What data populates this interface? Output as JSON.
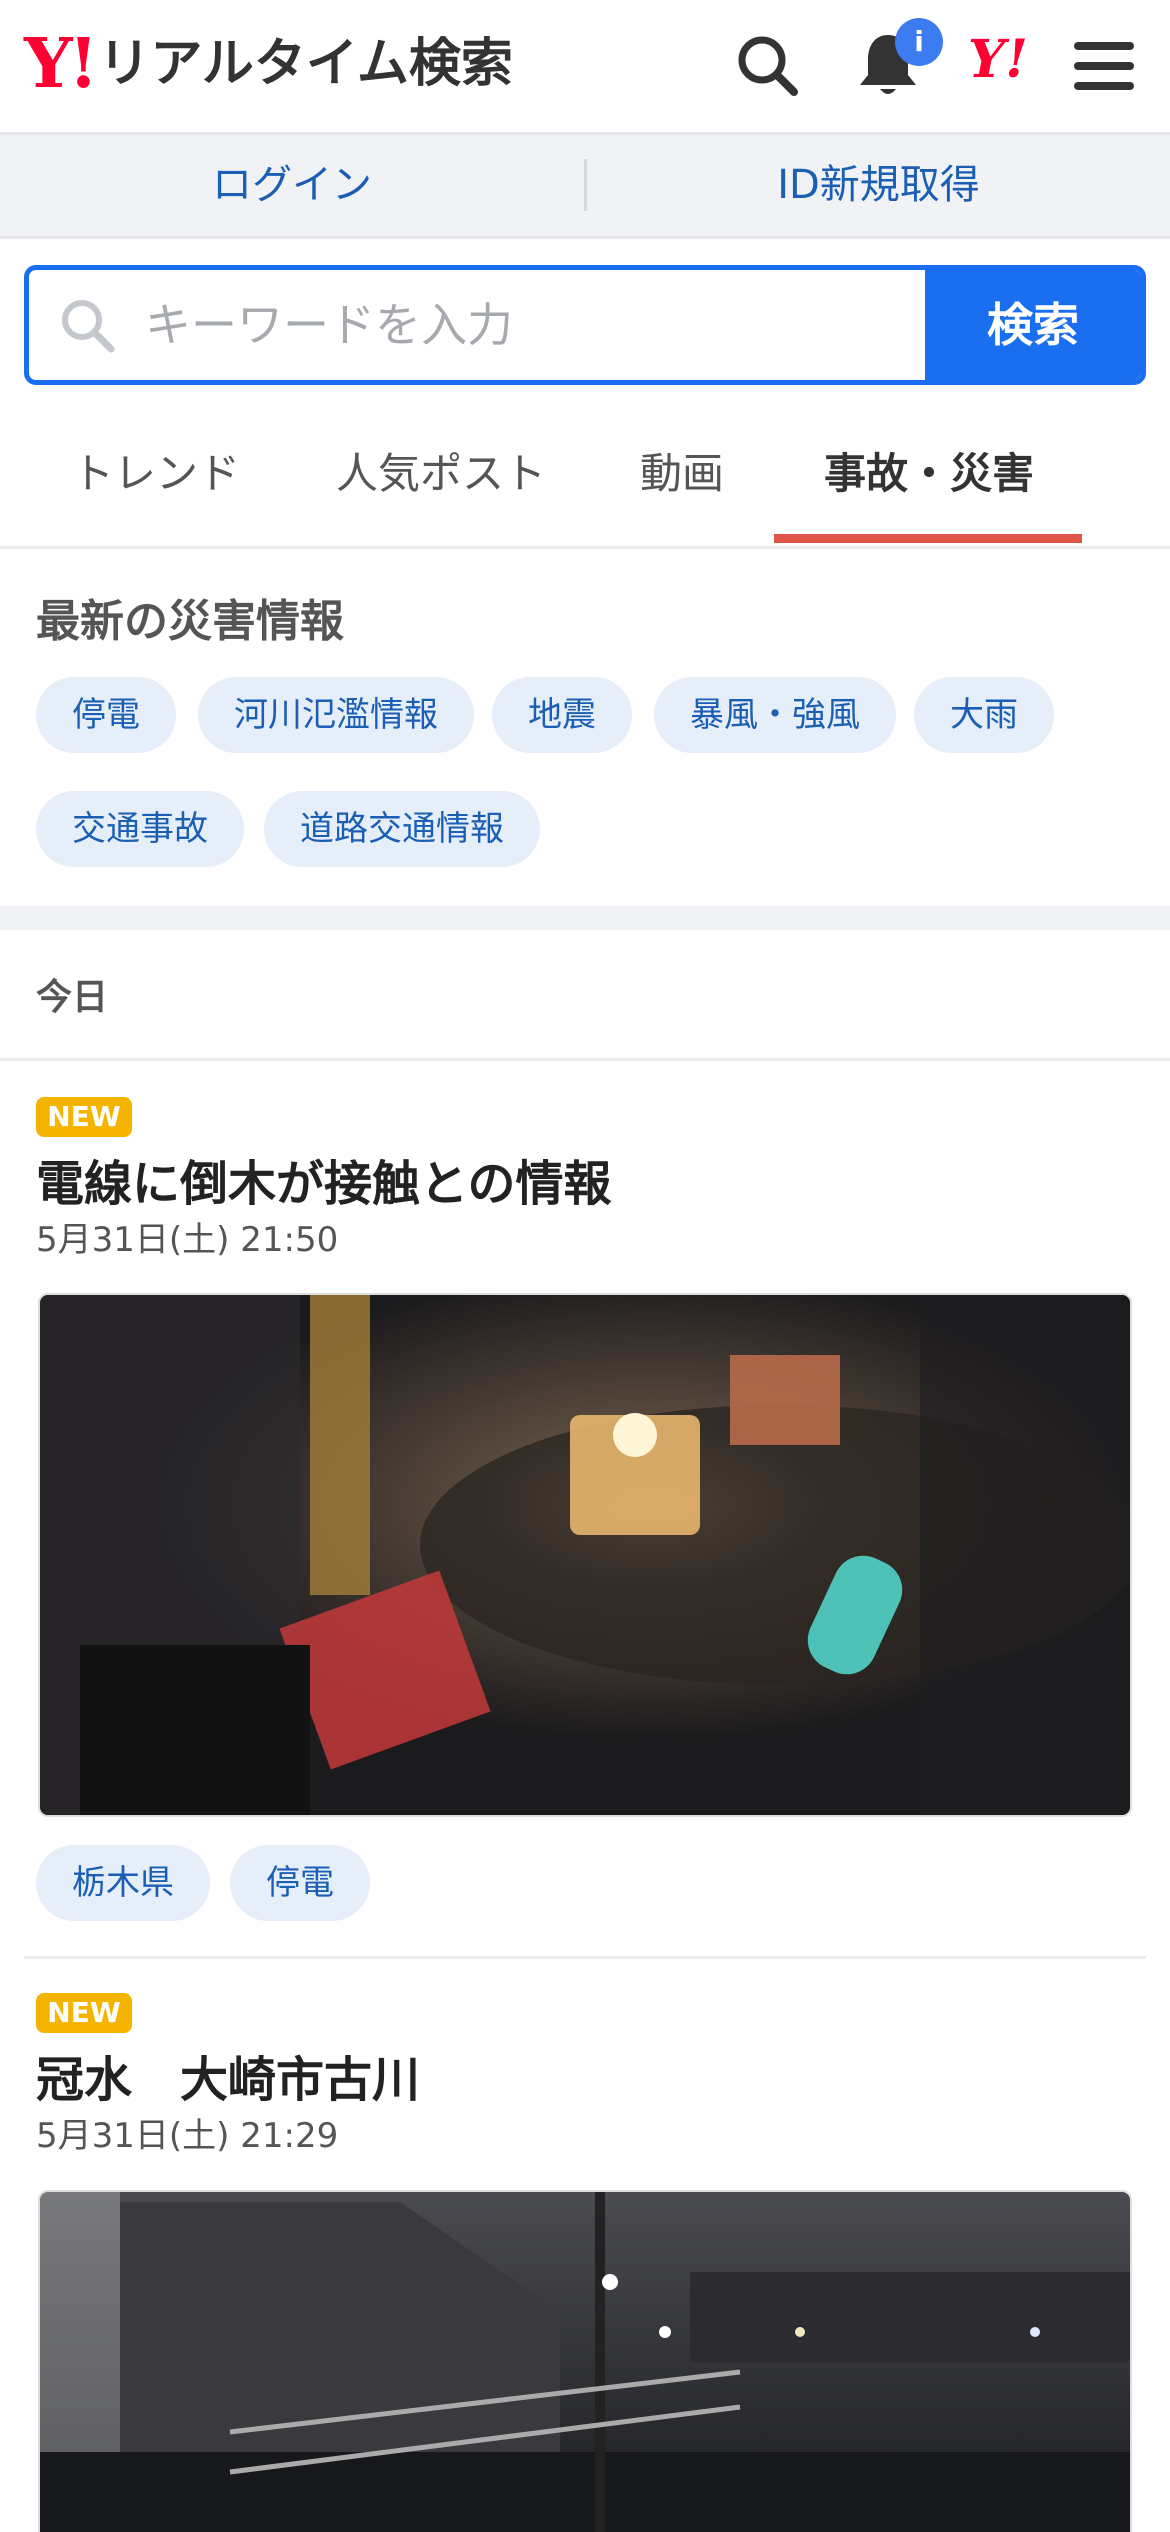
{
  "header": {
    "logo_mark": "Y!",
    "title": "リアルタイム検索",
    "notification_badge": "i",
    "yahoo_mark": "Y!"
  },
  "account": {
    "login": "ログイン",
    "register": "ID新規取得"
  },
  "search": {
    "placeholder": "キーワードを入力",
    "button": "検索"
  },
  "tabs": [
    {
      "label": "トレンド"
    },
    {
      "label": "人気ポスト"
    },
    {
      "label": "動画"
    },
    {
      "label": "事故・災害",
      "active": true
    }
  ],
  "disaster": {
    "title": "最新の災害情報",
    "chips": [
      "停電",
      "河川氾濫情報",
      "地震",
      "暴風・強風",
      "大雨",
      "交通事故",
      "道路交通情報"
    ]
  },
  "feed": {
    "date_header": "今日",
    "posts": [
      {
        "badge": "NEW",
        "title": "電線に倒木が接触との情報",
        "date": "5月31日(土) 21:50",
        "tags": [
          "栃木県",
          "停電"
        ]
      },
      {
        "badge": "NEW",
        "title": "冠水　大崎市古川",
        "date": "5月31日(土) 21:29"
      }
    ]
  },
  "colors": {
    "accent_blue": "#1a6ff0",
    "brand_red": "#ff0033",
    "tab_underline": "#e0554a",
    "new_badge": "#f5b400",
    "chip_bg": "#e6eefa"
  }
}
